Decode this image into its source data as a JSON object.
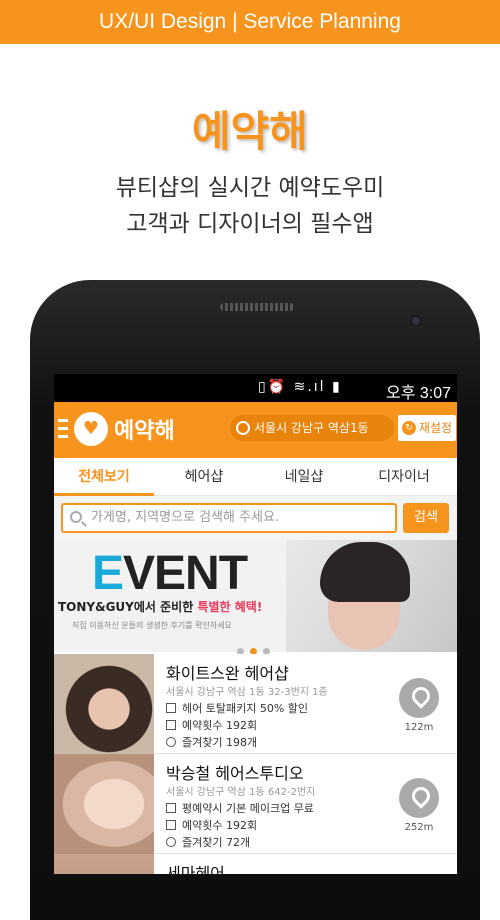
{
  "banner": {
    "text": "UX/UI Design | Service Planning"
  },
  "hero": {
    "title": "예약해",
    "subtitle_line1": "뷰티샵의 실시간 예약도우미",
    "subtitle_line2": "고객과 디자이너의 필수앱"
  },
  "statusbar": {
    "icons": "▯⏰ ≋.ıl ▮",
    "time": "오후 3:07"
  },
  "appbar": {
    "logo_text": "예약해",
    "location": "서울시 강남구 역삼1동",
    "reset_label": "재설정"
  },
  "tabs": [
    {
      "label": "전체보기"
    },
    {
      "label": "헤어샵"
    },
    {
      "label": "네일샵"
    },
    {
      "label": "디자이너"
    }
  ],
  "search": {
    "placeholder": "가게명, 지역명으로 검색해 주세요.",
    "button_label": "검색"
  },
  "event": {
    "title_first": "E",
    "title_rest": "VENT",
    "sub_prefix": "TONY&GUY에서 준비한 ",
    "sub_highlight": "특별한 혜택!",
    "note": "직접 이용하신 분들의 생생한 후기를 확인하세요",
    "page_count": 3,
    "active_page": 2
  },
  "shops": [
    {
      "name": "화이트스완 헤어샵",
      "address": "서울시 강남구 역삼 1동 32-3번지 1층",
      "promo": "헤어 토탈패키지 50% 할인",
      "bookings": "예약횟수 192회",
      "favorites": "즐겨찾기 198개",
      "distance": "122m"
    },
    {
      "name": "박승철 헤어스투디오",
      "address": "서울시 강남구 역삼 1동 642-2번지",
      "promo": "평예약시 기본 메이크업 무료",
      "bookings": "예약횟수 192회",
      "favorites": "즐겨찾기 72개",
      "distance": "252m"
    },
    {
      "name": "세마헤어"
    }
  ],
  "colors": {
    "accent": "#f7941d",
    "event_blue": "#1aa9d8",
    "event_red": "#e73c5c"
  }
}
